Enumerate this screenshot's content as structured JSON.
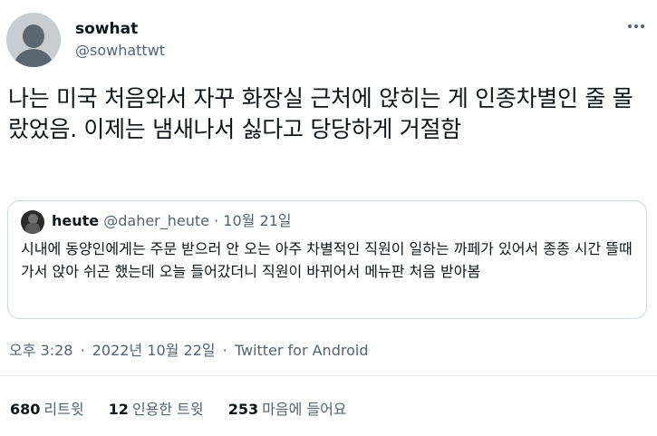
{
  "author": {
    "display_name": "sowhat",
    "handle": "@sowhattwt"
  },
  "icons": {
    "avatar": "default-profile-avatar",
    "more": "more-horizontal-icon",
    "quote_avatar": "profile-photo"
  },
  "tweet": {
    "text": "나는 미국 처음와서 자꾸 화장실 근처에 앉히는 게 인종차별인 줄 몰랐었음. 이제는 냄새나서 싫다고 당당하게 거절함"
  },
  "quoted_tweet": {
    "display_name": "heute",
    "handle": "@daher_heute",
    "separator": "·",
    "date": "10월 21일",
    "text": "시내에 동양인에게는 주문 받으러 안 오는 아주 차별적인 직원이 일하는 까페가 있어서 종종 시간 뜰때 가서 앉아 쉬곤 했는데 오늘 들어갔더니 직원이 바뀌어서 메뉴판 처음 받아봄"
  },
  "meta": {
    "time": "오후 3:28",
    "separator": "·",
    "date": "2022년 10월 22일",
    "source": "Twitter for Android"
  },
  "stats": {
    "retweets_count": "680",
    "retweets_label": "리트윗",
    "quotes_count": "12",
    "quotes_label": "인용한 트윗",
    "likes_count": "253",
    "likes_label": "마음에 들어요"
  },
  "colors": {
    "primary_text": "#0f1419",
    "secondary_text": "#536471",
    "border": "#cfd9de"
  }
}
